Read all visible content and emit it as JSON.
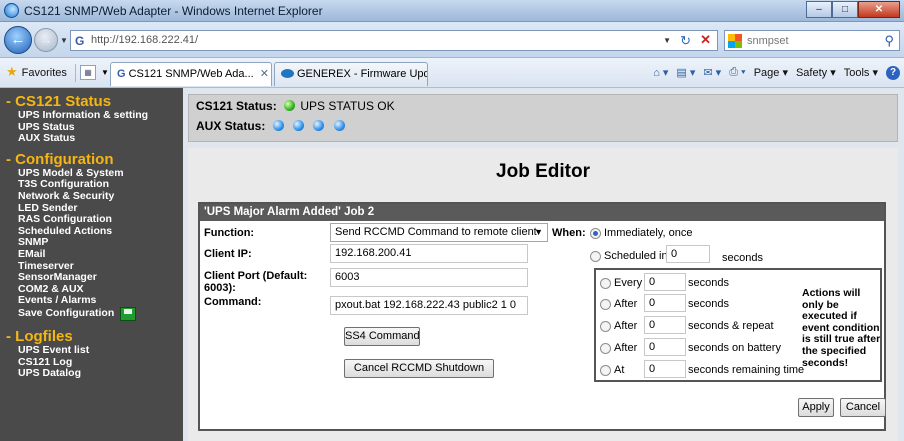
{
  "browser": {
    "window_title": "CS121 SNMP/Web Adapter - Windows Internet Explorer",
    "url": "http://192.168.222.41/",
    "search_text": "snmpset",
    "favorites_label": "Favorites",
    "tabs": [
      {
        "label": "CS121 SNMP/Web Ada...",
        "active": true
      },
      {
        "label": "GENEREX - Firmware Update",
        "active": false
      }
    ],
    "commands": {
      "page": "Page",
      "safety": "Safety",
      "tools": "Tools"
    }
  },
  "sidebar": {
    "sections": [
      {
        "title": "- CS121 Status",
        "items": [
          "UPS Information & setting",
          "UPS Status",
          "AUX Status"
        ]
      },
      {
        "title": "- Configuration",
        "items": [
          "UPS Model & System",
          "T3S Configuration",
          "Network & Security",
          "LED Sender",
          "RAS Configuration",
          "Scheduled Actions",
          "SNMP",
          "EMail",
          "Timeserver",
          "SensorManager",
          "COM2 & AUX",
          "Events / Alarms",
          "Save Configuration"
        ]
      },
      {
        "title": "- Logfiles",
        "items": [
          "UPS Event list",
          "CS121 Log",
          "UPS Datalog"
        ]
      }
    ]
  },
  "status": {
    "cs121_label": "CS121 Status:",
    "cs121_value": "UPS STATUS OK",
    "aux_label": "AUX Status:",
    "aux_leds": 4
  },
  "editor": {
    "page_title": "Job Editor",
    "header": "'UPS Major Alarm Added' Job 2",
    "function_label": "Function:",
    "function_value": "Send RCCMD Command to remote client",
    "client_ip_label": "Client IP:",
    "client_ip_value": "192.168.200.41",
    "client_port_label": "Client Port (Default: 6003):",
    "client_port_value": "6003",
    "command_label": "Command:",
    "command_value": "pxout.bat 192.168.222.43 public2 1 0",
    "ss4_button": "SS4 Command",
    "cancel_rccmd_button": "Cancel RCCMD Shutdown",
    "when_label": "When:",
    "immediately_label": "Immediately, once",
    "scheduled_label": "Scheduled in",
    "scheduled_value": "0",
    "scheduled_unit": "seconds",
    "schedule_options": [
      {
        "prefix": "Every",
        "value": "0",
        "unit": "seconds"
      },
      {
        "prefix": "After",
        "value": "0",
        "unit": "seconds"
      },
      {
        "prefix": "After",
        "value": "0",
        "unit": "seconds & repeat"
      },
      {
        "prefix": "After",
        "value": "0",
        "unit": "seconds on battery"
      },
      {
        "prefix": "At",
        "value": "0",
        "unit": "seconds remaining time"
      }
    ],
    "note": "Actions will only be executed if event condition is still true after the specified seconds!",
    "apply_button": "Apply",
    "cancel_button": "Cancel"
  }
}
